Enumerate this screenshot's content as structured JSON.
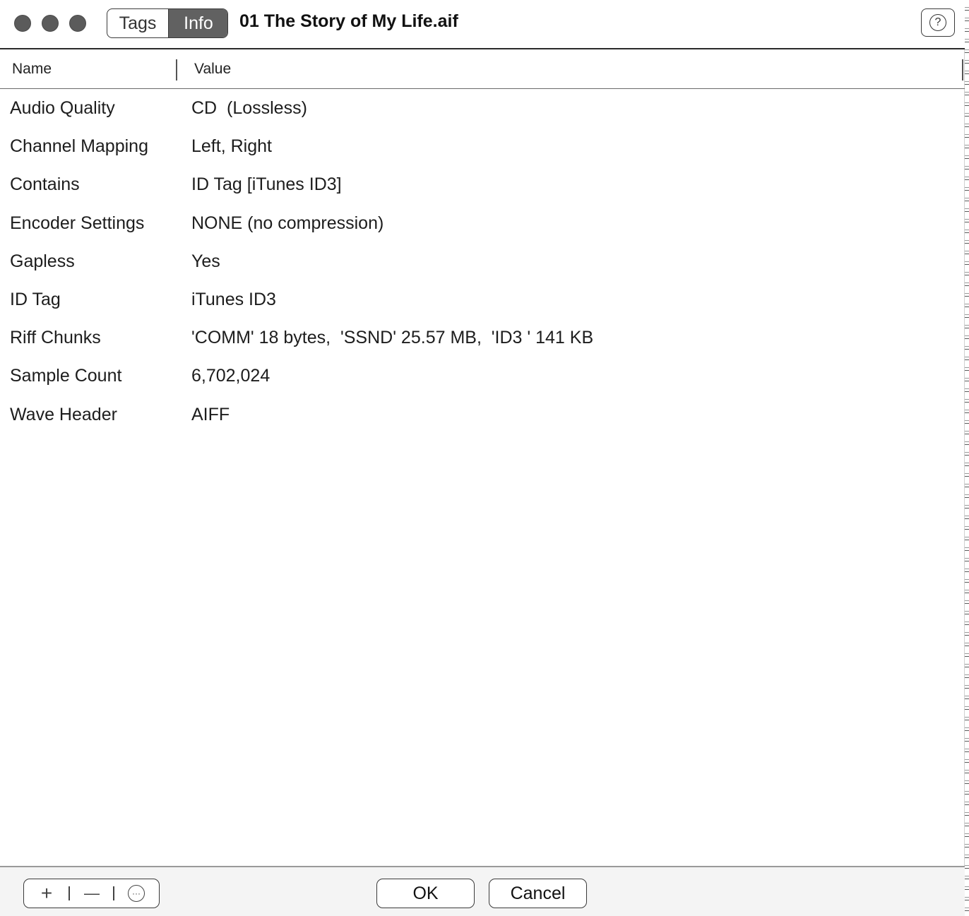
{
  "window": {
    "title": "01 The Story of My Life.aif",
    "tabs": [
      {
        "label": "Tags",
        "selected": false
      },
      {
        "label": "Info",
        "selected": true
      }
    ],
    "help_label": "?"
  },
  "table": {
    "columns": [
      "Name",
      "Value"
    ],
    "rows": [
      {
        "name": "Audio Quality",
        "value": "CD  (Lossless)"
      },
      {
        "name": "Channel Mapping",
        "value": "Left, Right"
      },
      {
        "name": "Contains",
        "value": "ID Tag [iTunes ID3]"
      },
      {
        "name": "Encoder Settings",
        "value": "NONE (no compression)"
      },
      {
        "name": "Gapless",
        "value": "Yes"
      },
      {
        "name": "ID Tag",
        "value": "iTunes ID3"
      },
      {
        "name": "Riff Chunks",
        "value": "'COMM' 18 bytes,  'SSND' 25.57 MB,  'ID3 ' 141 KB"
      },
      {
        "name": "Sample Count",
        "value": "6,702,024"
      },
      {
        "name": "Wave Header",
        "value": "AIFF"
      }
    ]
  },
  "footer": {
    "add_label": "+",
    "remove_label": "—",
    "more_label": "···",
    "ok_label": "OK",
    "cancel_label": "Cancel"
  },
  "colors": {
    "traffic_light": "#5b5b5b",
    "selected_tab_bg": "#616161",
    "footer_bg": "#f4f4f4"
  },
  "icons": [
    "close-traffic-icon",
    "minimize-traffic-icon",
    "zoom-traffic-icon",
    "help-icon",
    "plus-icon",
    "minus-icon",
    "more-icon"
  ]
}
